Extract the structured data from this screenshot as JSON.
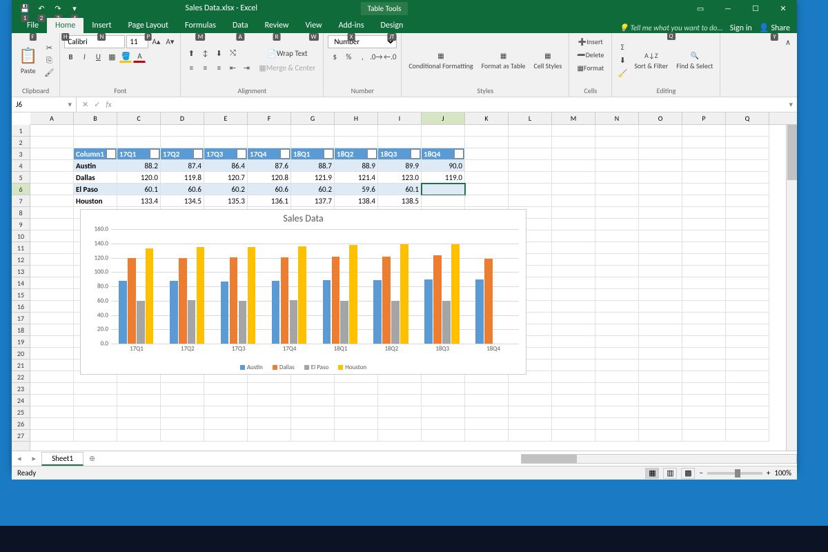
{
  "app_title": "Sales Data.xlsx - Excel",
  "context_tab_group": "Table Tools",
  "qat_keytips": [
    "1",
    "2",
    "3",
    "4"
  ],
  "tabs": [
    "File",
    "Home",
    "Insert",
    "Page Layout",
    "Formulas",
    "Data",
    "Review",
    "View",
    "Add-ins",
    "Design"
  ],
  "tab_keytips": [
    "F",
    "H",
    "N",
    "P",
    "M",
    "A",
    "R",
    "W",
    "X",
    "JT"
  ],
  "tell_me_placeholder": "Tell me what you want to do...",
  "tell_me_keytip": "Q",
  "share_keytip": "Y",
  "sign_in": "Sign in",
  "share": "Share",
  "ribbon": {
    "clipboard": {
      "paste": "Paste",
      "label": "Clipboard"
    },
    "font": {
      "name": "Calibri",
      "size": "11",
      "label": "Font"
    },
    "alignment": {
      "wrap": "Wrap Text",
      "merge": "Merge & Center",
      "label": "Alignment"
    },
    "number": {
      "format": "Number",
      "label": "Number"
    },
    "styles": {
      "cf": "Conditional Formatting",
      "fat": "Format as Table",
      "cs": "Cell Styles",
      "label": "Styles"
    },
    "cells": {
      "insert": "Insert",
      "delete": "Delete",
      "format": "Format",
      "label": "Cells"
    },
    "editing": {
      "sort": "Sort & Filter",
      "find": "Find & Select",
      "label": "Editing"
    }
  },
  "name_box": "J6",
  "columns": [
    "A",
    "B",
    "C",
    "D",
    "E",
    "F",
    "G",
    "H",
    "I",
    "J",
    "K",
    "L",
    "M",
    "N",
    "O",
    "P",
    "Q"
  ],
  "row_count": 27,
  "active_row": 6,
  "active_col": "J",
  "table": {
    "start_col": 1,
    "start_row": 3,
    "headers": [
      "Column1",
      "17Q1",
      "17Q2",
      "17Q3",
      "17Q4",
      "18Q1",
      "18Q2",
      "18Q3",
      "18Q4"
    ],
    "rows": [
      {
        "label": "Austin",
        "v": [
          88.2,
          87.4,
          86.4,
          87.6,
          88.7,
          88.9,
          89.9,
          90.0
        ]
      },
      {
        "label": "Dallas",
        "v": [
          120.0,
          119.8,
          120.7,
          120.8,
          121.9,
          121.4,
          123.0,
          119.0
        ]
      },
      {
        "label": "El Paso",
        "v": [
          60.1,
          60.6,
          60.2,
          60.6,
          60.2,
          59.6,
          60.1,
          null
        ]
      },
      {
        "label": "Houston",
        "v": [
          133.4,
          134.5,
          135.3,
          136.1,
          137.7,
          138.4,
          138.5,
          null
        ]
      }
    ]
  },
  "chart_data": {
    "type": "bar",
    "title": "Sales Data",
    "categories": [
      "17Q1",
      "17Q2",
      "17Q3",
      "17Q4",
      "18Q1",
      "18Q2",
      "18Q3",
      "18Q4"
    ],
    "series": [
      {
        "name": "Austin",
        "color": "#5b9bd5",
        "values": [
          88.2,
          87.4,
          86.4,
          87.6,
          88.7,
          88.9,
          89.9,
          90.0
        ]
      },
      {
        "name": "Dallas",
        "color": "#ed7d31",
        "values": [
          120.0,
          119.8,
          120.7,
          120.8,
          121.9,
          121.4,
          123.0,
          119.0
        ]
      },
      {
        "name": "El Paso",
        "color": "#a5a5a5",
        "values": [
          60.1,
          60.6,
          60.2,
          60.6,
          60.2,
          59.6,
          60.1,
          null
        ]
      },
      {
        "name": "Houston",
        "color": "#ffc000",
        "values": [
          133.4,
          134.5,
          135.3,
          136.1,
          137.7,
          138.4,
          138.5,
          null
        ]
      }
    ],
    "ylim": [
      0,
      160
    ],
    "ystep": 20
  },
  "sheet_tab": "Sheet1",
  "status": "Ready",
  "zoom": "100%"
}
